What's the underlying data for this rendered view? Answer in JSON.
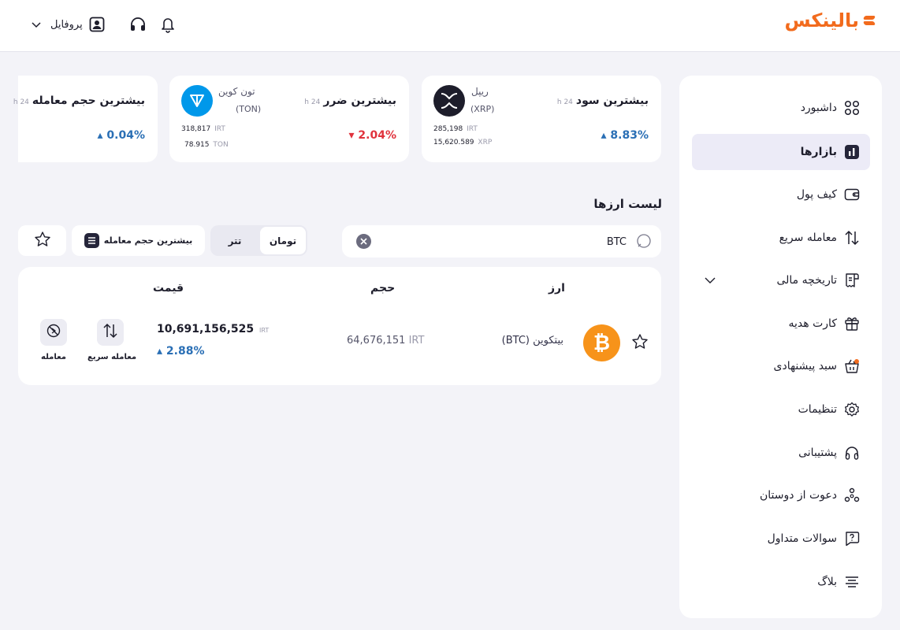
{
  "header": {
    "logo_text": "بالینکس",
    "profile_label": "پروفایل"
  },
  "sidebar": {
    "items": [
      {
        "label": "داشبورد",
        "icon": "dashboard-icon"
      },
      {
        "label": "بازارها",
        "icon": "markets-icon",
        "active": true
      },
      {
        "label": "کیف پول",
        "icon": "wallet-icon"
      },
      {
        "label": "معامله سریع",
        "icon": "swap-icon"
      },
      {
        "label": "تاریخچه مالی",
        "icon": "history-icon"
      },
      {
        "label": "کارت هدیه",
        "icon": "gift-icon"
      },
      {
        "label": "سبد پیشنهادی",
        "icon": "basket-icon"
      },
      {
        "label": "تنظیمات",
        "icon": "gear-icon"
      },
      {
        "label": "پشتیبانی",
        "icon": "headset-icon"
      },
      {
        "label": "دعوت از دوستان",
        "icon": "invite-icon"
      },
      {
        "label": "سوالات متداول",
        "icon": "faq-icon"
      },
      {
        "label": "بلاگ",
        "icon": "blog-icon"
      }
    ]
  },
  "stats": {
    "top_gain": {
      "title": "بیشترین سود",
      "period": "24 h",
      "coin_name": "ریپل",
      "coin_symbol": "(XRP)",
      "price_irt": "285,198",
      "price_unit": "IRT",
      "amount": "15,620.589",
      "amount_unit": "XRP",
      "change": "8.83%",
      "direction": "up"
    },
    "top_loss": {
      "title": "بیشترین ضرر",
      "period": "24 h",
      "coin_name": "تون کوین",
      "coin_symbol": "(TON)",
      "price_irt": "318,817",
      "price_unit": "IRT",
      "amount": "78.915",
      "amount_unit": "TON",
      "change": "2.04%",
      "direction": "down"
    },
    "top_volume": {
      "title": "بیشترین حجم معامله",
      "period": "24 h",
      "change": "0.04%",
      "direction": "up"
    }
  },
  "list": {
    "title": "لیست ارزها",
    "search_value": "BTC",
    "quote_options": [
      "تومان",
      "تتر"
    ],
    "quote_selected": "تومان",
    "sort_label": "بیشترین حجم معامله",
    "columns": {
      "asset": "ارز",
      "volume": "حجم",
      "price": "قیمت"
    },
    "rows": [
      {
        "name": "بیتکوین (BTC)",
        "volume": "64,676,151",
        "volume_unit": "IRT",
        "price": "10,691,156,525",
        "price_unit": "IRT",
        "change": "2.88%",
        "direction": "up",
        "action_quick": "معامله سریع",
        "action_trade": "معامله"
      }
    ]
  },
  "colors": {
    "brand": "#f26b1d",
    "up": "#2a6fb5",
    "down": "#e0323c",
    "active_bg": "#ecebf7",
    "btc": "#f7931a",
    "ton": "#0098ea"
  }
}
